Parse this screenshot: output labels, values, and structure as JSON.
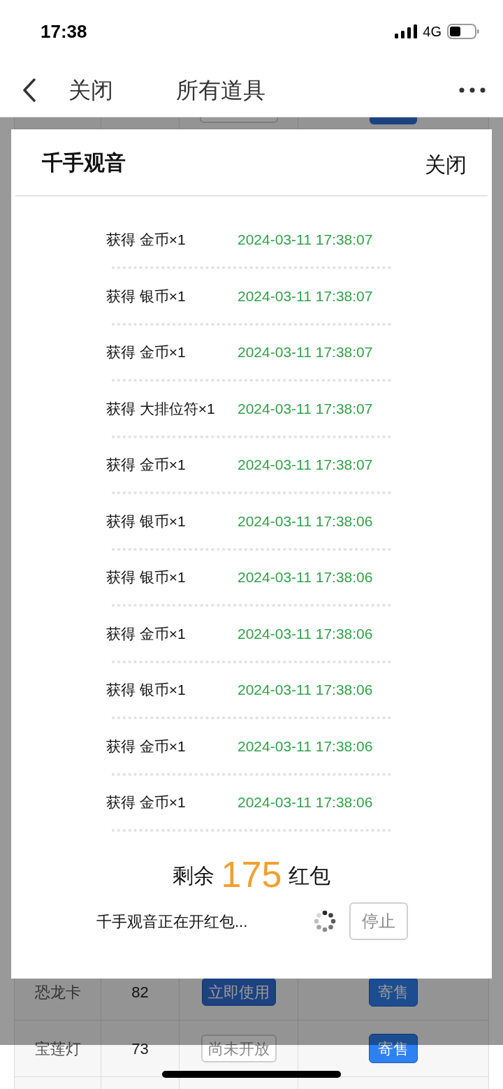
{
  "status_bar": {
    "time": "17:38",
    "network": "4G"
  },
  "nav": {
    "back_label": "关闭",
    "title": "所有道具"
  },
  "table": {
    "rows": [
      {
        "kind": "partial",
        "use_button": {
          "disabled": true
        },
        "sell_button": {}
      },
      {
        "kind": "full",
        "name": "恐龙卡",
        "count": "82",
        "use_button": {
          "label": "立即使用",
          "disabled": false
        },
        "sell_button": {
          "label": "寄售"
        }
      },
      {
        "kind": "full",
        "name": "宝莲灯",
        "count": "73",
        "use_button": {
          "label": "尚未开放",
          "disabled": true
        },
        "sell_button": {
          "label": "寄售"
        }
      },
      {
        "kind": "empty"
      }
    ]
  },
  "dialog": {
    "title": "千手观音",
    "close_label": "关闭",
    "records": [
      {
        "item": "获得 金币×1",
        "time": "2024-03-11 17:38:07"
      },
      {
        "item": "获得 银币×1",
        "time": "2024-03-11 17:38:07"
      },
      {
        "item": "获得 金币×1",
        "time": "2024-03-11 17:38:07"
      },
      {
        "item": "获得 大排位符×1",
        "time": "2024-03-11 17:38:07"
      },
      {
        "item": "获得 金币×1",
        "time": "2024-03-11 17:38:07"
      },
      {
        "item": "获得 银币×1",
        "time": "2024-03-11 17:38:06"
      },
      {
        "item": "获得 银币×1",
        "time": "2024-03-11 17:38:06"
      },
      {
        "item": "获得 金币×1",
        "time": "2024-03-11 17:38:06"
      },
      {
        "item": "获得 银币×1",
        "time": "2024-03-11 17:38:06"
      },
      {
        "item": "获得 金币×1",
        "time": "2024-03-11 17:38:06"
      },
      {
        "item": "获得 金币×1",
        "time": "2024-03-11 17:38:06"
      }
    ],
    "remaining_label": "剩余",
    "remaining_count": "175",
    "remaining_unit": "红包",
    "status": "千手观音正在开红包...",
    "stop_label": "停止"
  }
}
